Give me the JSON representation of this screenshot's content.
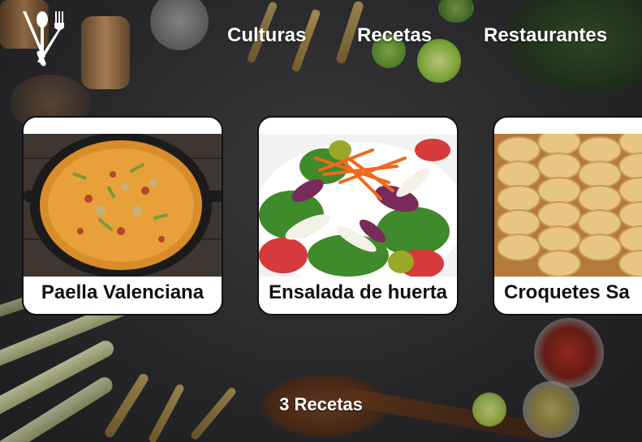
{
  "nav": {
    "items": [
      {
        "label": "Culturas"
      },
      {
        "label": "Recetas"
      },
      {
        "label": "Restaurantes"
      }
    ]
  },
  "recipes": [
    {
      "title": "Paella Valenciana"
    },
    {
      "title": "Ensalada de huerta"
    },
    {
      "title": "Croquetes Sa"
    }
  ],
  "footer": {
    "count_label": "3 Recetas"
  },
  "colors": {
    "card_bg": "#ffffff",
    "card_border": "#111111",
    "text_on_dark": "#ffffff"
  },
  "icons": {
    "logo": "crossed-fork-spoon-knife-icon"
  }
}
